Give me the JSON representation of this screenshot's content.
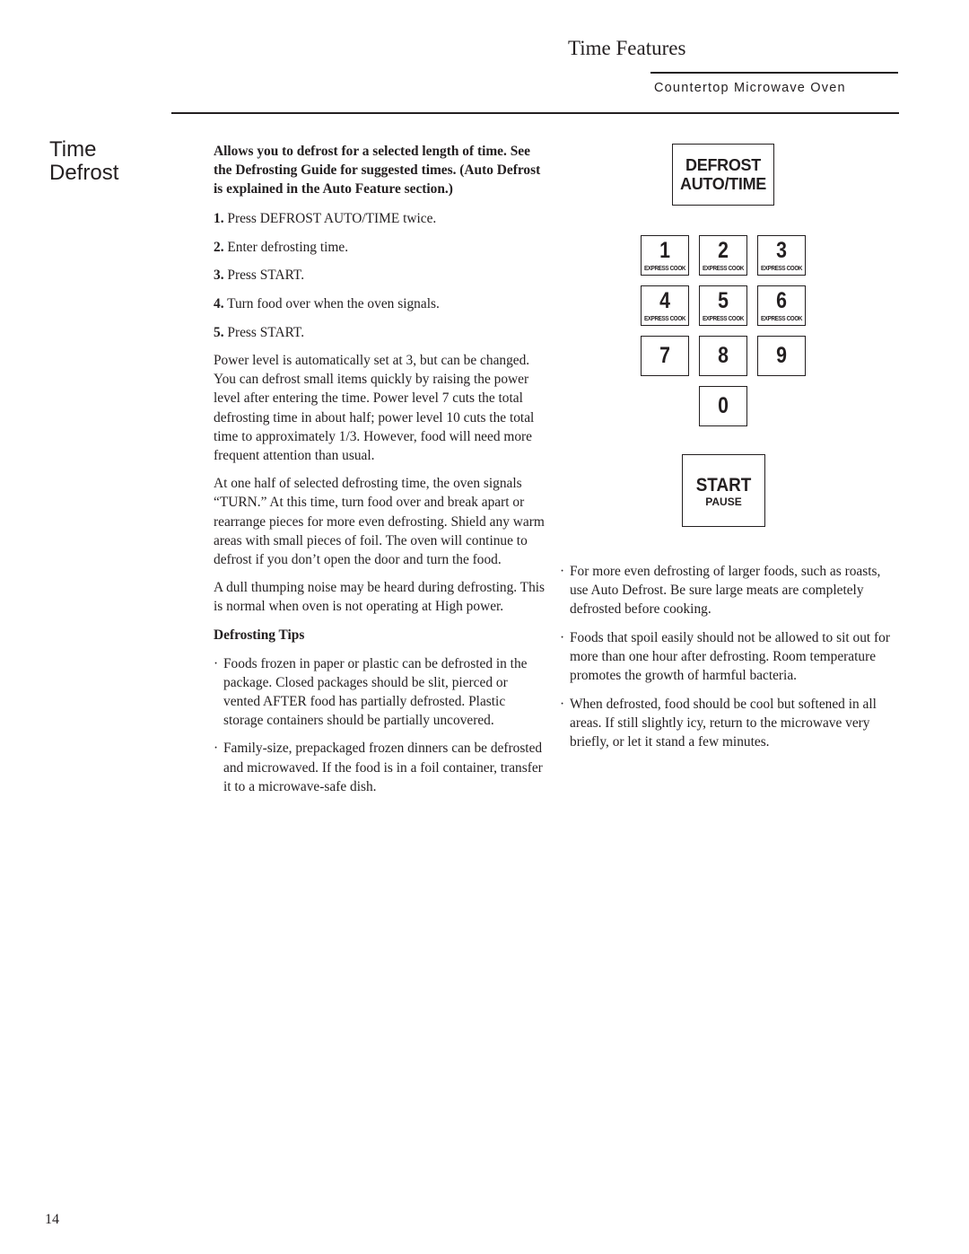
{
  "header": {
    "title": "Time Features",
    "subtitle": "Countertop Microwave Oven"
  },
  "section": {
    "title_line1": "Time",
    "title_line2": "Defrost"
  },
  "intro": "Allows you to defrost for a selected length of time. See the Defrosting Guide for suggested times. (Auto Defrost is explained in the Auto Feature section.)",
  "steps": [
    {
      "num": "1.",
      "text": "Press DEFROST AUTO/TIME twice."
    },
    {
      "num": "2.",
      "text": "Enter defrosting time."
    },
    {
      "num": "3.",
      "text": "Press START."
    },
    {
      "num": "4.",
      "text": "Turn food over when the oven signals."
    },
    {
      "num": "5.",
      "text": "Press START."
    }
  ],
  "paragraphs": [
    "Power level is automatically set at 3, but can be changed. You can defrost small items quickly by raising the power level after entering the time. Power level 7 cuts the total defrosting time in about half; power level 10 cuts the total time to approximately 1/3. However, food will need more frequent attention than usual.",
    "At one half of selected defrosting time, the oven signals “TURN.” At this time, turn food over and break apart or rearrange pieces for more even defrosting. Shield any warm areas with small pieces of foil. The oven will continue to defrost if you don’t open the door and turn the food.",
    "A dull thumping noise may be heard during defrosting. This is normal when oven is not operating at High power."
  ],
  "tips": {
    "heading": "Defrosting Tips",
    "bullet_char": "·",
    "left": [
      "Foods frozen in paper or plastic can be defrosted in the package. Closed packages should be slit, pierced or vented AFTER food has partially defrosted. Plastic storage containers should be partially uncovered.",
      "Family-size, prepackaged frozen dinners can be defrosted and microwaved. If the food is in a foil container, transfer it to a microwave-safe dish."
    ],
    "right": [
      "For more even defrosting of larger foods, such as roasts, use Auto Defrost. Be sure large meats are completely defrosted before cooking.",
      "Foods that spoil easily should not be allowed to sit out for more than one hour after defrosting. Room temperature promotes the growth of harmful bacteria.",
      "When defrosted, food should be cool but softened in all areas. If still slightly icy, return to the microwave very briefly, or let it stand a few minutes."
    ]
  },
  "keypad": {
    "defrost": {
      "line1": "DEFROST",
      "line2": "AUTO/TIME"
    },
    "express_label": "EXPRESS COOK",
    "keys": [
      "1",
      "2",
      "3",
      "4",
      "5",
      "6",
      "7",
      "8",
      "9",
      "0"
    ],
    "start": {
      "label": "START",
      "sub": "PAUSE"
    }
  },
  "page_number": "14"
}
